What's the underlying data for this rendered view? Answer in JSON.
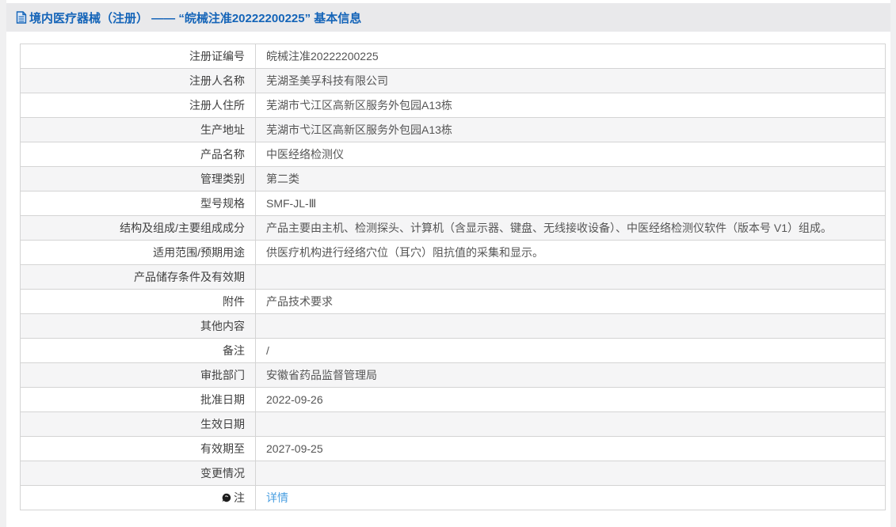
{
  "colors": {
    "page_bg": "#f0f0f1",
    "panel_bg": "#ffffff",
    "header_band_bg": "#e9e9eb",
    "title_blue": "#1464b8",
    "link_blue": "#4a9fe1",
    "row_alt_bg": "#f5f5f6",
    "border": "#d4d4d4"
  },
  "header": {
    "icon": "document-icon",
    "title": "境内医疗器械（注册） —— “皖械注准20222200225” 基本信息"
  },
  "table": {
    "rows": [
      {
        "label": "注册证编号",
        "value": "皖械注准20222200225"
      },
      {
        "label": "注册人名称",
        "value": "芜湖圣美孚科技有限公司"
      },
      {
        "label": "注册人住所",
        "value": "芜湖市弋江区高新区服务外包园A13栋"
      },
      {
        "label": "生产地址",
        "value": "芜湖市弋江区高新区服务外包园A13栋"
      },
      {
        "label": "产品名称",
        "value": "中医经络检测仪"
      },
      {
        "label": "管理类别",
        "value": "第二类"
      },
      {
        "label": "型号规格",
        "value": "SMF-JL-Ⅲ"
      },
      {
        "label": "结构及组成/主要组成成分",
        "value": "产品主要由主机、检测探头、计算机（含显示器、键盘、无线接收设备）、中医经络检测仪软件（版本号 V1）组成。"
      },
      {
        "label": "适用范围/预期用途",
        "value": "供医疗机构进行经络穴位（耳穴）阻抗值的采集和显示。"
      },
      {
        "label": "产品储存条件及有效期",
        "value": ""
      },
      {
        "label": "附件",
        "value": "产品技术要求"
      },
      {
        "label": "其他内容",
        "value": ""
      },
      {
        "label": "备注",
        "value": "/"
      },
      {
        "label": "审批部门",
        "value": "安徽省药品监督管理局"
      },
      {
        "label": "批准日期",
        "value": "2022-09-26"
      },
      {
        "label": "生效日期",
        "value": ""
      },
      {
        "label": "有效期至",
        "value": "2027-09-25"
      },
      {
        "label": "变更情况",
        "value": ""
      },
      {
        "label": "注",
        "label_icon": "comment-icon",
        "value": "详情",
        "value_is_link": true
      }
    ]
  }
}
